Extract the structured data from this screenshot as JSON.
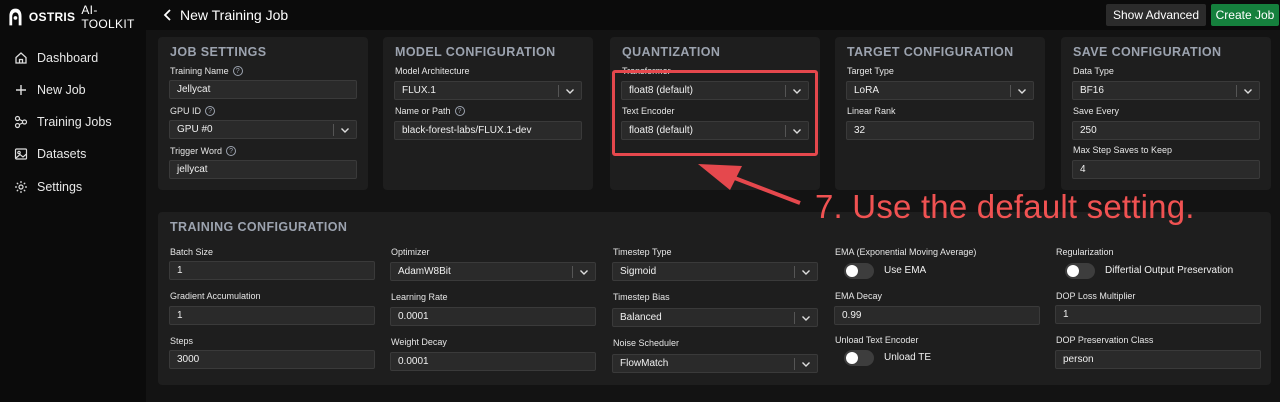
{
  "brand": {
    "name": "OSTRIS",
    "sub": "AI-TOOLKIT"
  },
  "sidebar": {
    "items": [
      {
        "label": "Dashboard",
        "icon": "home-icon"
      },
      {
        "label": "New Job",
        "icon": "plus-icon"
      },
      {
        "label": "Training Jobs",
        "icon": "nodes-icon"
      },
      {
        "label": "Datasets",
        "icon": "image-icon"
      },
      {
        "label": "Settings",
        "icon": "gear-icon"
      }
    ]
  },
  "header": {
    "title": "New Training Job",
    "show_advanced": "Show Advanced",
    "create_job": "Create Job"
  },
  "job_settings": {
    "title": "JOB SETTINGS",
    "training_name_label": "Training Name",
    "training_name_value": "Jellycat",
    "gpu_id_label": "GPU ID",
    "gpu_id_value": "GPU #0",
    "trigger_word_label": "Trigger Word",
    "trigger_word_value": "jellycat"
  },
  "model_configuration": {
    "title": "MODEL CONFIGURATION",
    "architecture_label": "Model Architecture",
    "architecture_value": "FLUX.1",
    "name_path_label": "Name or Path",
    "name_path_value": "black-forest-labs/FLUX.1-dev"
  },
  "quantization": {
    "title": "QUANTIZATION",
    "transformer_label": "Transformer",
    "transformer_value": "float8 (default)",
    "text_encoder_label": "Text Encoder",
    "text_encoder_value": "float8 (default)"
  },
  "target_configuration": {
    "title": "TARGET CONFIGURATION",
    "target_type_label": "Target Type",
    "target_type_value": "LoRA",
    "linear_rank_label": "Linear Rank",
    "linear_rank_value": "32"
  },
  "save_configuration": {
    "title": "SAVE CONFIGURATION",
    "data_type_label": "Data Type",
    "data_type_value": "BF16",
    "save_every_label": "Save Every",
    "save_every_value": "250",
    "max_step_saves_label": "Max Step Saves to Keep",
    "max_step_saves_value": "4"
  },
  "training_configuration": {
    "title": "TRAINING CONFIGURATION",
    "batch_size_label": "Batch Size",
    "batch_size_value": "1",
    "grad_accum_label": "Gradient Accumulation",
    "grad_accum_value": "1",
    "steps_label": "Steps",
    "steps_value": "3000",
    "optimizer_label": "Optimizer",
    "optimizer_value": "AdamW8Bit",
    "learning_rate_label": "Learning Rate",
    "learning_rate_value": "0.0001",
    "weight_decay_label": "Weight Decay",
    "weight_decay_value": "0.0001",
    "timestep_type_label": "Timestep Type",
    "timestep_type_value": "Sigmoid",
    "timestep_bias_label": "Timestep Bias",
    "timestep_bias_value": "Balanced",
    "noise_scheduler_label": "Noise Scheduler",
    "noise_scheduler_value": "FlowMatch",
    "ema_label": "EMA (Exponential Moving Average)",
    "use_ema_label": "Use EMA",
    "ema_decay_label": "EMA Decay",
    "ema_decay_value": "0.99",
    "unload_te_section_label": "Unload Text Encoder",
    "unload_te_label": "Unload TE",
    "regularization_label": "Regularization",
    "dop_toggle_label": "Differtial Output Preservation",
    "dop_multiplier_label": "DOP Loss Multiplier",
    "dop_multiplier_value": "1",
    "dop_class_label": "DOP Preservation Class",
    "dop_class_value": "person"
  },
  "annotation": {
    "text": "7. Use the default setting.",
    "color": "#e5484d"
  },
  "colors": {
    "accent_green": "#15803d",
    "panel_bg": "#1e1e1e",
    "annotation_red": "#e5484d"
  }
}
